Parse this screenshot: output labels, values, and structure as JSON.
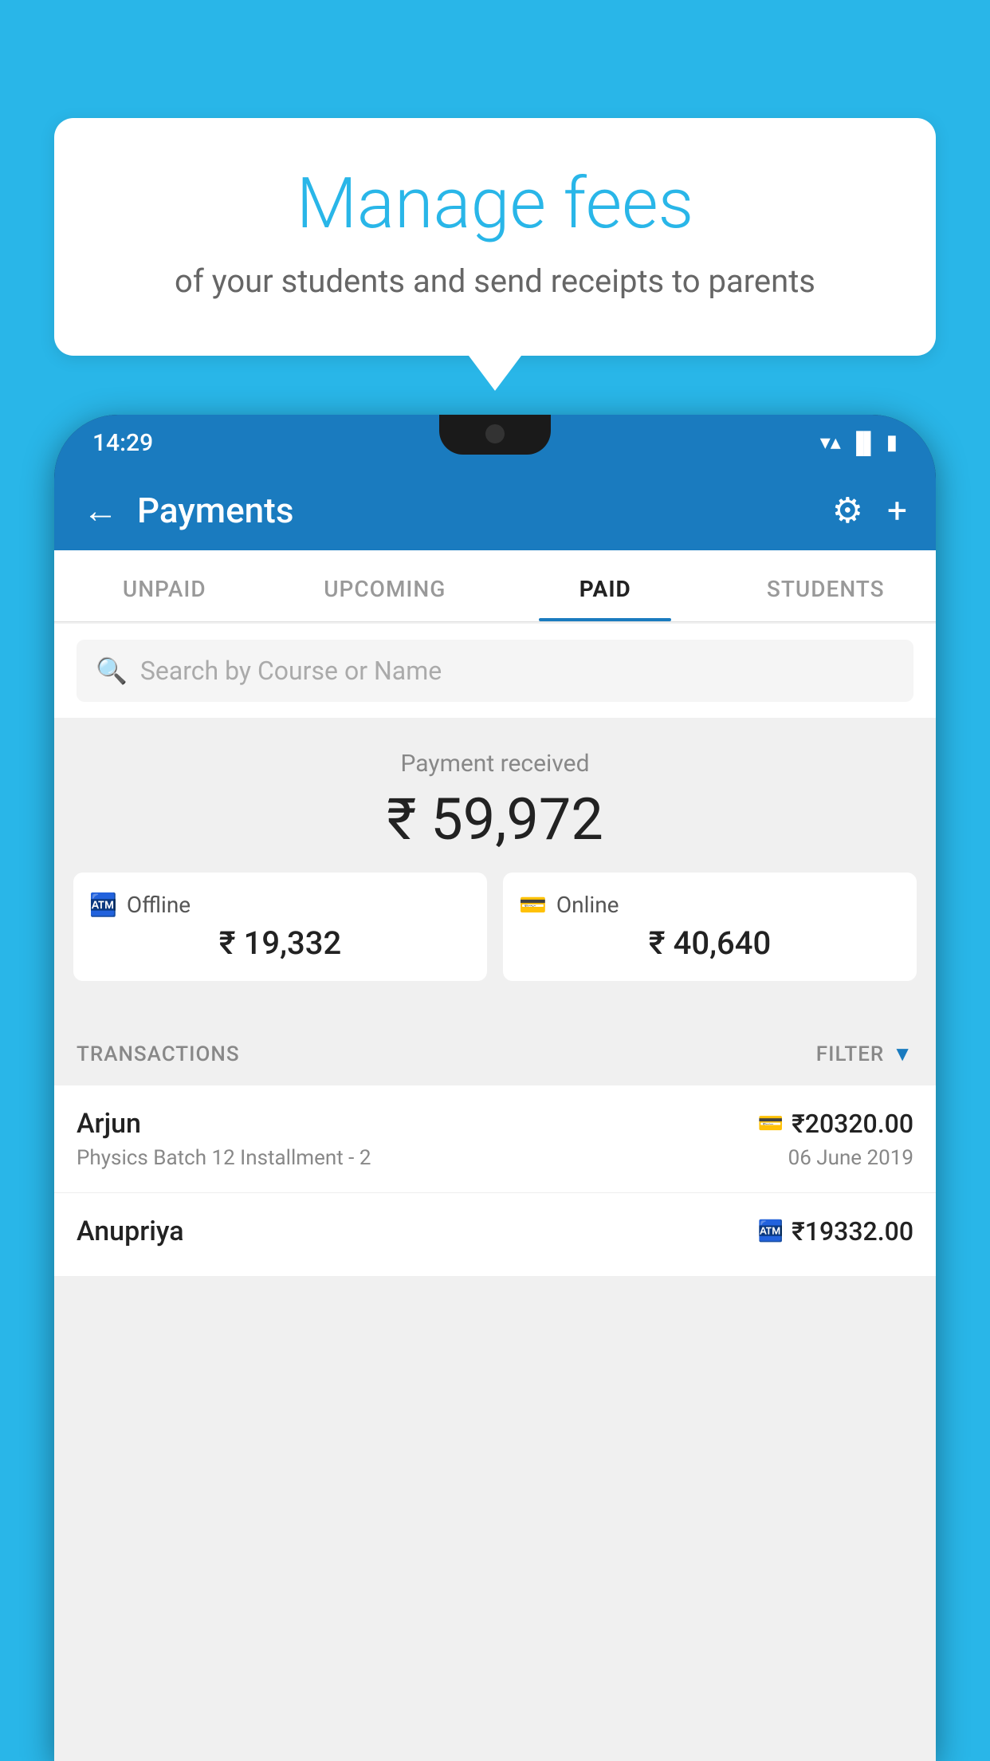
{
  "background_color": "#29b6e8",
  "speech_bubble": {
    "title": "Manage fees",
    "subtitle": "of your students and send receipts to parents"
  },
  "status_bar": {
    "time": "14:29",
    "icons": [
      "wifi",
      "signal",
      "battery"
    ]
  },
  "app_header": {
    "title": "Payments",
    "back_label": "←",
    "settings_label": "⚙",
    "add_label": "+"
  },
  "tabs": [
    {
      "label": "UNPAID",
      "active": false
    },
    {
      "label": "UPCOMING",
      "active": false
    },
    {
      "label": "PAID",
      "active": true
    },
    {
      "label": "STUDENTS",
      "active": false
    }
  ],
  "search": {
    "placeholder": "Search by Course or Name"
  },
  "payment_summary": {
    "label": "Payment received",
    "total_amount": "₹ 59,972",
    "offline_label": "Offline",
    "offline_amount": "₹ 19,332",
    "online_label": "Online",
    "online_amount": "₹ 40,640"
  },
  "transactions": {
    "header_label": "TRANSACTIONS",
    "filter_label": "FILTER",
    "rows": [
      {
        "name": "Arjun",
        "course": "Physics Batch 12 Installment - 2",
        "amount": "₹20320.00",
        "date": "06 June 2019",
        "payment_type": "card"
      },
      {
        "name": "Anupriya",
        "course": "",
        "amount": "₹19332.00",
        "date": "",
        "payment_type": "cash"
      }
    ]
  }
}
